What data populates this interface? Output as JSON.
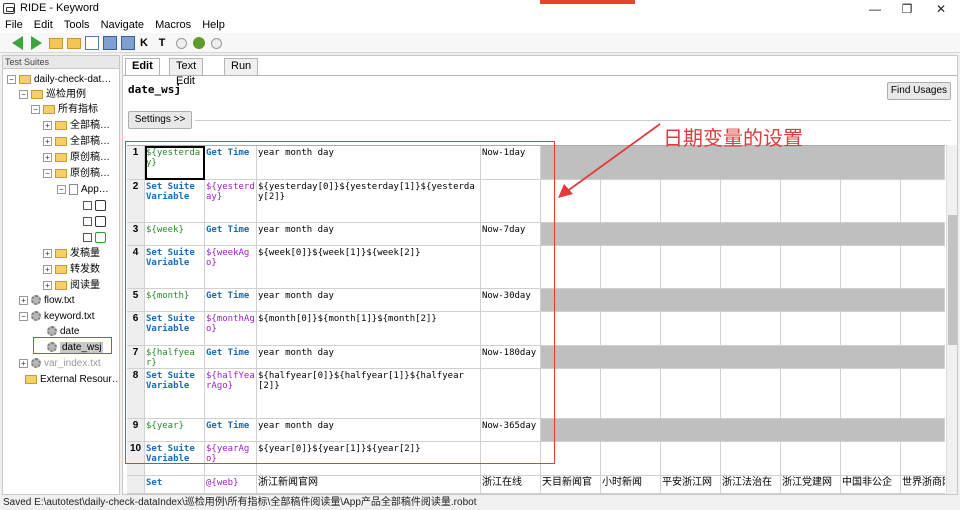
{
  "window": {
    "title": "RIDE - Keyword",
    "controls": [
      "—",
      "❐",
      "✕"
    ]
  },
  "menu": [
    "File",
    "Edit",
    "Tools",
    "Navigate",
    "Macros",
    "Help"
  ],
  "toolbar": {
    "icons": [
      "back-arrow-icon",
      "forward-arrow-icon",
      "open-folder-icon",
      "new-folder-icon",
      "new-file-icon",
      "save-icon",
      "save-all-icon",
      "keyword-icon",
      "test-icon",
      "play-icon",
      "bug-icon",
      "stop-icon"
    ],
    "k_label": "K",
    "t_label": "T"
  },
  "tree": {
    "title": "Test Suites",
    "nodes": [
      {
        "label": "daily-check-dat…"
      },
      {
        "label": "巡检用例"
      },
      {
        "label": "所有指标"
      },
      {
        "label": "全部稿…"
      },
      {
        "label": "全部稿…"
      },
      {
        "label": "原创稿…"
      },
      {
        "label": "原创稿…"
      },
      {
        "label": "App…"
      },
      {
        "label": "发稿量"
      },
      {
        "label": "转发数"
      },
      {
        "label": "阅读量"
      },
      {
        "label": "flow.txt"
      },
      {
        "label": "keyword.txt"
      },
      {
        "label": "date"
      },
      {
        "label": "date_wsj"
      },
      {
        "label": "var_index.txt"
      },
      {
        "label": "External Resour…"
      }
    ]
  },
  "editor": {
    "tabs": [
      "Edit",
      "Text Edit",
      "Run"
    ],
    "keyword_name": "date_wsj",
    "find_usages": "Find Usages",
    "settings": "Settings >>",
    "annotation": "日期变量的设置",
    "rows": [
      {
        "num": "1",
        "c1": "${yesterday}",
        "c2": "Get Time",
        "c3": "year month day",
        "c4": "Now-1day"
      },
      {
        "num": "2",
        "c1": "Set Suite Variable",
        "c2": "${yesterday}",
        "c3": "${yesterday[0]}${yesterday[1]}${yesterday[2]}",
        "c4": ""
      },
      {
        "num": "3",
        "c1": "${week}",
        "c2": "Get Time",
        "c3": "year month day",
        "c4": "Now-7day"
      },
      {
        "num": "4",
        "c1": "Set Suite Variable",
        "c2": "${weekAgo}",
        "c3": "${week[0]}${week[1]}${week[2]}",
        "c4": ""
      },
      {
        "num": "5",
        "c1": "${month}",
        "c2": "Get Time",
        "c3": "year month day",
        "c4": "Now-30day"
      },
      {
        "num": "6",
        "c1": "Set Suite Variable",
        "c2": "${monthAgo}",
        "c3": "${month[0]}${month[1]}${month[2]}",
        "c4": ""
      },
      {
        "num": "7",
        "c1": "${halfyear}",
        "c2": "Get Time",
        "c3": "year month day",
        "c4": "Now-180day"
      },
      {
        "num": "8",
        "c1": "Set Suite Variable",
        "c2": "${halfYearAgo}",
        "c3": "${halfyear[0]}${halfyear[1]}${halfyear[2]}",
        "c4": ""
      },
      {
        "num": "9",
        "c1": "${year}",
        "c2": "Get Time",
        "c3": "year month day",
        "c4": "Now-365day"
      },
      {
        "num": "10",
        "c1": "Set Suite Variable",
        "c2": "${yearAgo}",
        "c3": "${year[0]}${year[1]}${year[2]}",
        "c4": ""
      },
      {
        "num": "",
        "c1": "Set",
        "c2": "@{web}",
        "c3": "浙江新闻官网",
        "c4": "浙江在线"
      }
    ],
    "extra_row_cells": [
      "天目新闻官",
      "小时新闻",
      "平安浙江网",
      "浙江法治在",
      "浙江党建网",
      "中国非公企",
      "世界浙商网"
    ]
  },
  "status": "Saved E:\\autotest\\daily-check-dataIndex\\巡检用例\\所有指标\\全部稿件阅读量\\App产品全部稿件阅读量.robot",
  "colors": {
    "annotation": "#e23b3b",
    "variable": "#2a8a2a",
    "keyword": "#1a6ab5",
    "assigned_variable": "#a020c8"
  }
}
